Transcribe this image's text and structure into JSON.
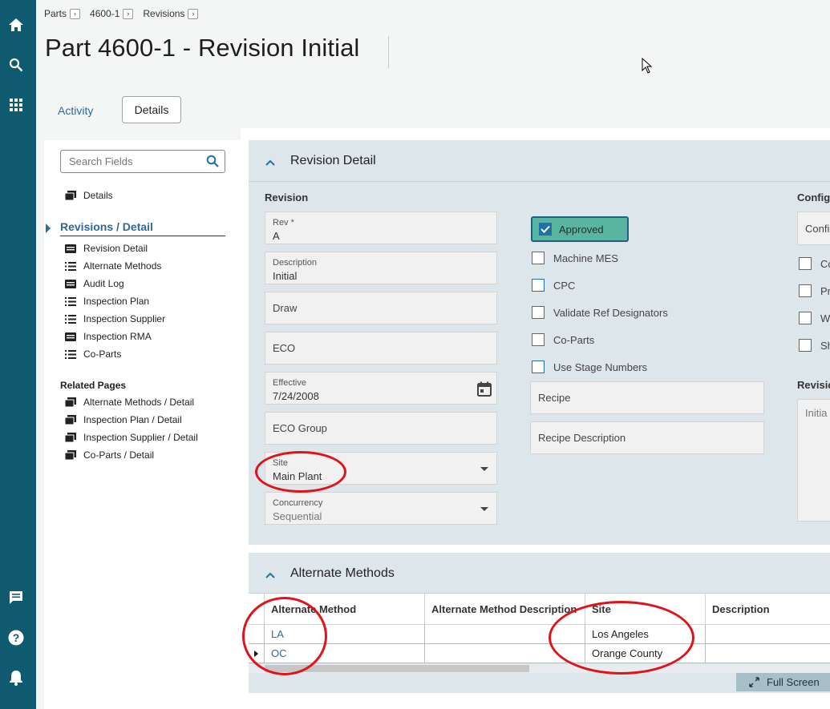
{
  "breadcrumb": [
    "Parts",
    "4600-1",
    "Revisions"
  ],
  "page_title": "Part 4600-1 - Revision Initial",
  "tabs": {
    "activity": "Activity",
    "details": "Details"
  },
  "nav": {
    "search_placeholder": "Search Fields",
    "details": "Details",
    "section": "Revisions / Detail",
    "items": [
      "Revision Detail",
      "Alternate Methods",
      "Audit Log",
      "Inspection Plan",
      "Inspection Supplier",
      "Inspection RMA",
      "Co-Parts"
    ],
    "related_title": "Related Pages",
    "related": [
      "Alternate Methods / Detail",
      "Inspection Plan / Detail",
      "Inspection Supplier / Detail",
      "Co-Parts / Detail"
    ]
  },
  "revision_detail": {
    "title": "Revision Detail",
    "section_revision": "Revision",
    "section_config": "Configu",
    "section_revision_right": "Revisio",
    "fields": {
      "rev": {
        "label": "Rev *",
        "value": "A"
      },
      "description": {
        "label": "Description",
        "value": "Initial"
      },
      "draw": "Draw",
      "eco": "ECO",
      "effective": {
        "label": "Effective",
        "value": "7/24/2008"
      },
      "eco_group": "ECO Group",
      "site": {
        "label": "Site",
        "value": "Main Plant"
      },
      "concurrency": {
        "label": "Concurrency",
        "value": "Sequential"
      },
      "recipe": "Recipe",
      "recipe_description": "Recipe Description",
      "config": "Confi",
      "revision_text": "Initia"
    },
    "checkboxes": [
      "Approved",
      "Machine MES",
      "CPC",
      "Validate Ref Designators",
      "Co-Parts",
      "Use Stage Numbers"
    ],
    "right_checkboxes": [
      "Co",
      "Pr",
      "We",
      "Sh"
    ]
  },
  "alternate_methods": {
    "title": "Alternate Methods",
    "columns": [
      "Alternate Method",
      "Alternate Method Description",
      "Site",
      "Description"
    ],
    "rows": [
      {
        "method": "LA",
        "description": "",
        "site": "Los Angeles",
        "desc2": ""
      },
      {
        "method": "OC",
        "description": "",
        "site": "Orange County",
        "desc2": ""
      }
    ],
    "full_screen": "Full Screen"
  },
  "colors": {
    "rail": "#0f5a6e",
    "link": "#2c6a9a",
    "card": "#dde6ea",
    "approved": "#5ab5a0",
    "annotation": "#e0131a"
  },
  "icons": [
    "home-icon",
    "search-icon",
    "apps-grid-icon",
    "chat-icon",
    "help-icon",
    "bell-icon",
    "calendar-icon",
    "chevron-right-icon",
    "chevron-up-icon",
    "checkmark-icon",
    "expand-icon"
  ]
}
